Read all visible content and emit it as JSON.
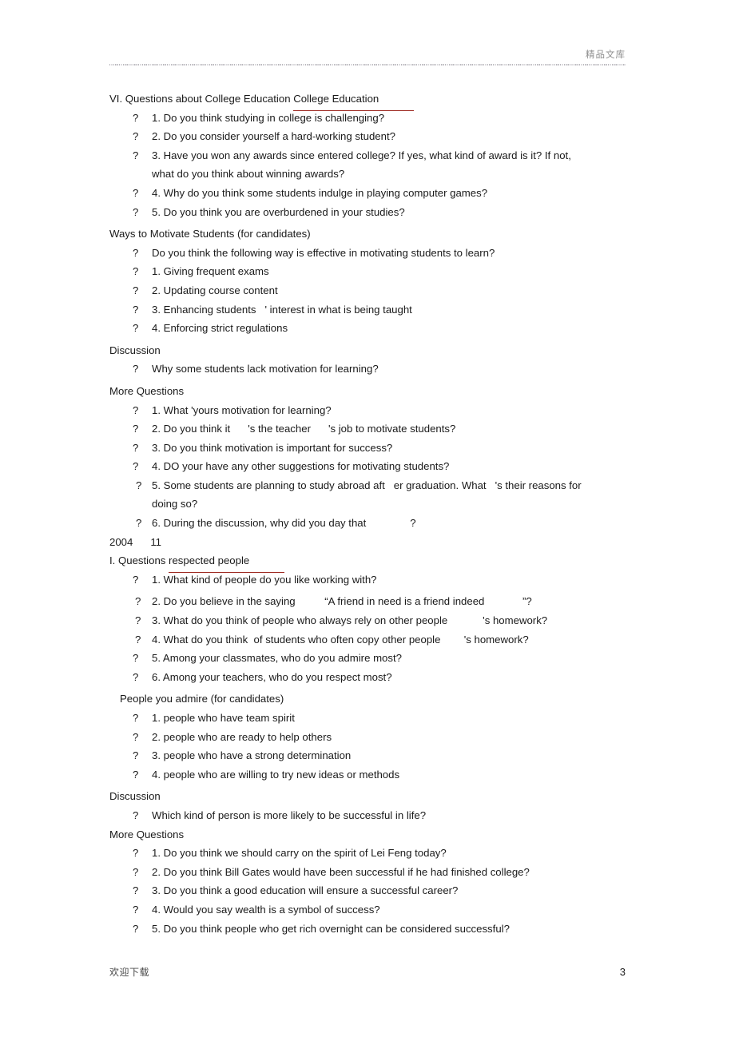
{
  "header": {
    "watermark": "精品文库"
  },
  "footer": {
    "note": "欢迎下载",
    "page_number": "3"
  },
  "bullet_glyph": "?",
  "sections": {
    "college_education": {
      "heading_prefix": "VI. Questions about College Education ",
      "heading_underlined": "College Education",
      "items": [
        "1. Do you think studying in college is challenging?",
        "2. Do you consider yourself a hard-working student?",
        "3. Have you won any awards since entered college? If yes, what kind of award is it? If not,",
        "4. Why do you think some students indulge in playing computer games?",
        "5. Do you think you are overburdened in your studies?"
      ],
      "item3_continuation": "what do you think about winning awards?"
    },
    "ways_to_motivate": {
      "heading": "Ways to Motivate Students (for candidates)",
      "items": [
        "Do you think the following way is effective in motivating students to learn?",
        "1. Giving frequent exams",
        "2. Updating course content",
        "3. Enhancing students   ' interest in what is being taught",
        "4. Enforcing strict regulations"
      ]
    },
    "discussion_1": {
      "heading": "Discussion",
      "items": [
        "Why some students lack motivation for learning?"
      ]
    },
    "more_questions_1": {
      "heading": "More Questions",
      "items": [
        "1. What 'yours motivation for learning?",
        "2. Do you think it      's the teacher      's job to motivate students?",
        "3. Do you think motivation is important for success?",
        "4. DO your have any other suggestions for motivating students?",
        "5. Some students are planning to study abroad aft   er graduation. What   's their reasons for",
        "6. During the discussion, why did you day that               ?"
      ],
      "item5_continuation": "doing so?"
    },
    "year_line": "2004      11",
    "respected_people": {
      "heading_prefix": "I. Questions ",
      "heading_underlined": "respected people",
      "items": [
        "1. What kind of people do you like working with?",
        "2. Do you believe in the saying          “A friend in need is a friend indeed             ”?",
        "3. What do you think of people who always rely on other people            's homework?",
        "4. What do you think  of students who often copy other people        's homework?",
        "5. Among your classmates, who do you admire most?",
        "6. Among your teachers, who do you respect most?"
      ]
    },
    "people_you_admire": {
      "heading": "People you admire (for candidates)",
      "items": [
        "1. people who have team spirit",
        "2. people who are ready to help others",
        "3. people who have a strong determination",
        "4. people who are willing to try new ideas or methods"
      ]
    },
    "discussion_2": {
      "heading": "Discussion",
      "items": [
        "Which kind of person is more likely to be successful in life?"
      ]
    },
    "more_questions_2": {
      "heading": "More Questions",
      "items": [
        "1. Do you think we should carry on the spirit of Lei Feng today?",
        "2. Do you think Bill Gates would have been successful if he had finished college?",
        "3. Do you think a good education will ensure a successful career?",
        "4. Would you say wealth is a symbol of success?",
        "5. Do you think people who get rich overnight can be considered successful?"
      ]
    }
  }
}
